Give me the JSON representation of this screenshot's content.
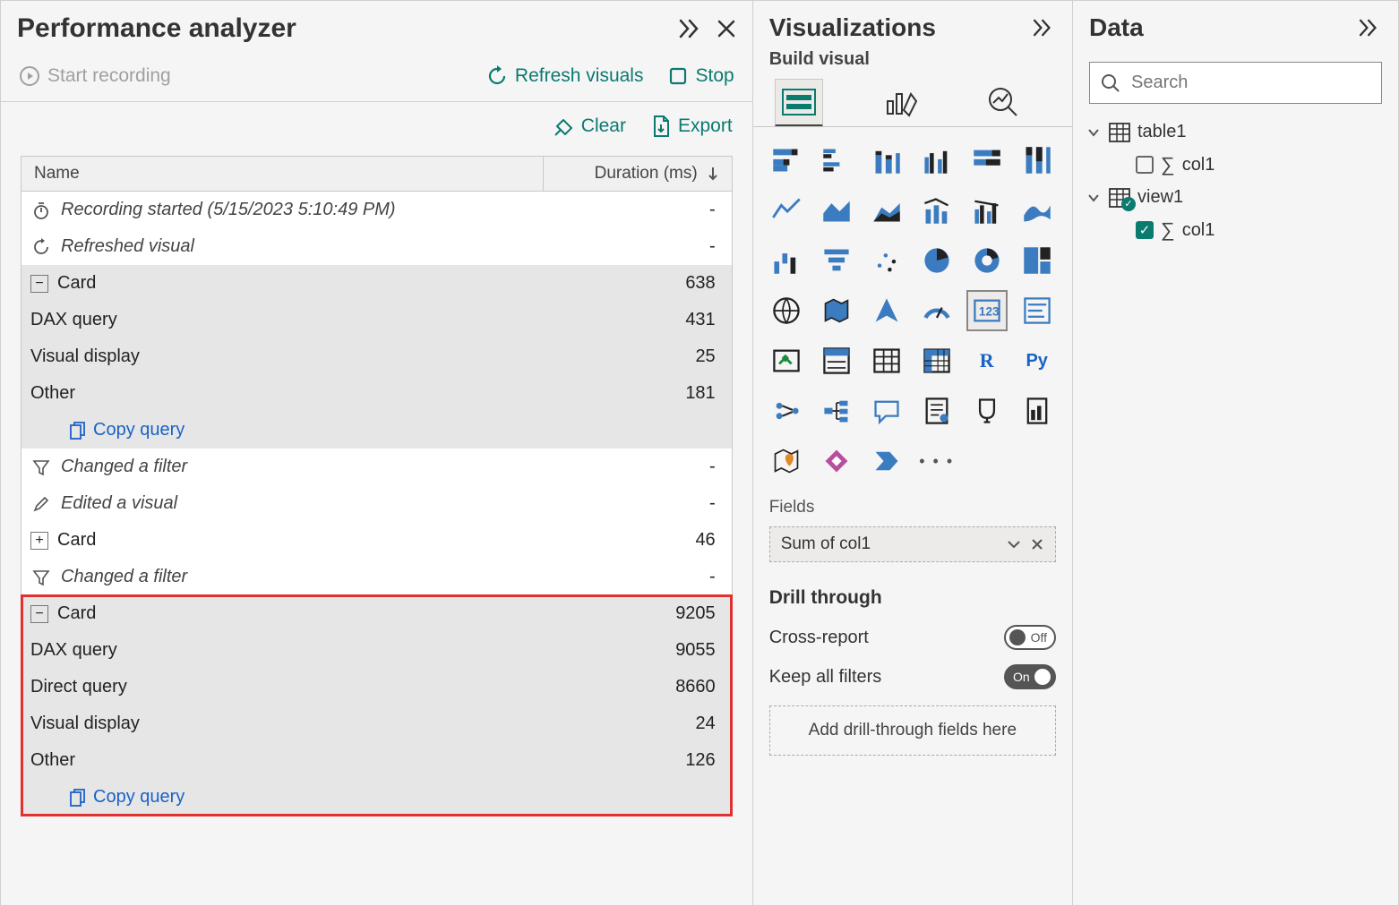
{
  "perf": {
    "title": "Performance analyzer",
    "start_recording": "Start recording",
    "refresh_visuals": "Refresh visuals",
    "stop": "Stop",
    "clear": "Clear",
    "export": "Export",
    "col_name": "Name",
    "col_duration": "Duration (ms)",
    "copy_query": "Copy query",
    "rows": {
      "r0": {
        "label": "Recording started (5/15/2023 5:10:49 PM)",
        "dur": "-"
      },
      "r1": {
        "label": "Refreshed visual",
        "dur": "-"
      },
      "r2": {
        "label": "Card",
        "dur": "638"
      },
      "r2a": {
        "label": "DAX query",
        "dur": "431"
      },
      "r2b": {
        "label": "Visual display",
        "dur": "25"
      },
      "r2c": {
        "label": "Other",
        "dur": "181"
      },
      "r3": {
        "label": "Changed a filter",
        "dur": "-"
      },
      "r4": {
        "label": "Edited a visual",
        "dur": "-"
      },
      "r5": {
        "label": "Card",
        "dur": "46"
      },
      "r6": {
        "label": "Changed a filter",
        "dur": "-"
      },
      "r7": {
        "label": "Card",
        "dur": "9205"
      },
      "r7a": {
        "label": "DAX query",
        "dur": "9055"
      },
      "r7b": {
        "label": "Direct query",
        "dur": "8660"
      },
      "r7c": {
        "label": "Visual display",
        "dur": "24"
      },
      "r7d": {
        "label": "Other",
        "dur": "126"
      }
    }
  },
  "viz": {
    "title": "Visualizations",
    "subtitle": "Build visual",
    "fields_label": "Fields",
    "field_value": "Sum of col1",
    "drill_title": "Drill through",
    "cross_report": "Cross-report",
    "keep_filters": "Keep all filters",
    "off": "Off",
    "on": "On",
    "drop_hint": "Add drill-through fields here",
    "more": "• • •",
    "icons": {
      "i0": "stacked-bar-icon",
      "i1": "clustered-bar-icon",
      "i2": "stacked-column-icon",
      "i3": "clustered-column-icon",
      "i4": "stacked-bar-100-icon",
      "i5": "stacked-column-100-icon",
      "i6": "line-icon",
      "i7": "area-icon",
      "i8": "stacked-area-icon",
      "i9": "line-stacked-column-icon",
      "i10": "line-clustered-column-icon",
      "i11": "ribbon-icon",
      "i12": "waterfall-icon",
      "i13": "funnel-icon",
      "i14": "scatter-icon",
      "i15": "pie-icon",
      "i16": "donut-icon",
      "i17": "treemap-icon",
      "i18": "map-icon",
      "i19": "filled-map-icon",
      "i20": "azure-map-icon",
      "i21": "gauge-icon",
      "i22": "card-icon",
      "i23": "multi-row-card-icon",
      "i24": "kpi-icon",
      "i25": "slicer-icon",
      "i26": "table-icon",
      "i27": "matrix-icon",
      "i28": "r-visual-icon",
      "i29": "python-visual-icon",
      "i30": "key-influencers-icon",
      "i31": "decomposition-tree-icon",
      "i32": "qa-icon",
      "i33": "narrative-icon",
      "i34": "goals-icon",
      "i35": "paginated-report-icon",
      "i36": "arcgis-map-icon",
      "i37": "power-apps-icon",
      "i38": "power-automate-icon",
      "i39": "more-visuals-icon"
    }
  },
  "data": {
    "title": "Data",
    "search_placeholder": "Search",
    "table1": "table1",
    "col1": "col1",
    "view1": "view1"
  }
}
